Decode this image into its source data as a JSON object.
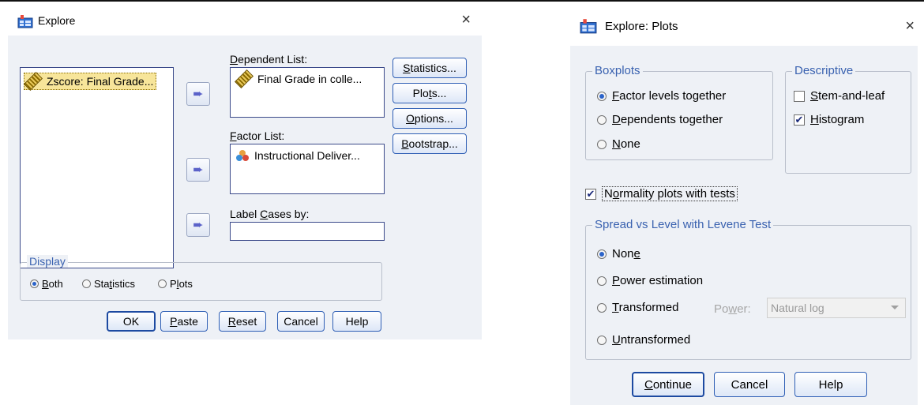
{
  "explore": {
    "title": "Explore",
    "close": "×",
    "variables": [
      {
        "label": "Zscore: Final Grade...",
        "icon": "ruler-icon"
      }
    ],
    "dependent_list": {
      "label_pre": "",
      "label_ul": "D",
      "label_post": "ependent List:",
      "items": [
        "Final Grade in colle..."
      ]
    },
    "factor_list": {
      "label_pre": "",
      "label_ul": "F",
      "label_post": "actor List:",
      "items": [
        "Instructional Deliver..."
      ]
    },
    "label_cases": {
      "label_pre": "Label ",
      "label_ul": "C",
      "label_post": "ases by:",
      "value": ""
    },
    "side_buttons": [
      {
        "pre": "",
        "ul": "S",
        "post": "tatistics..."
      },
      {
        "pre": "Plo",
        "ul": "t",
        "post": "s..."
      },
      {
        "pre": "",
        "ul": "O",
        "post": "ptions..."
      },
      {
        "pre": "",
        "ul": "B",
        "post": "ootstrap..."
      }
    ],
    "display": {
      "title": "Display",
      "options": [
        {
          "pre": "",
          "ul": "B",
          "post": "oth",
          "checked": true
        },
        {
          "pre": "Sta",
          "ul": "t",
          "post": "istics",
          "checked": false
        },
        {
          "pre": "P",
          "ul": "l",
          "post": "ots",
          "checked": false
        }
      ]
    },
    "buttons": [
      {
        "pre": "OK",
        "ul": "",
        "post": ""
      },
      {
        "pre": "",
        "ul": "P",
        "post": "aste"
      },
      {
        "pre": "",
        "ul": "R",
        "post": "eset"
      },
      {
        "pre": "Cancel",
        "ul": "",
        "post": ""
      },
      {
        "pre": "Help",
        "ul": "",
        "post": ""
      }
    ]
  },
  "plots": {
    "title": "Explore: Plots",
    "close": "×",
    "boxplots": {
      "title": "Boxplots",
      "options": [
        {
          "pre": "",
          "ul": "F",
          "post": "actor levels together",
          "checked": true
        },
        {
          "pre": "",
          "ul": "D",
          "post": "ependents together",
          "checked": false
        },
        {
          "pre": "",
          "ul": "N",
          "post": "one",
          "checked": false
        }
      ]
    },
    "descriptive": {
      "title": "Descriptive",
      "options": [
        {
          "pre": "",
          "ul": "S",
          "post": "tem-and-leaf",
          "checked": false,
          "mark": ""
        },
        {
          "pre": "",
          "ul": "H",
          "post": "istogram",
          "checked": true,
          "mark": "✔"
        }
      ]
    },
    "normality": {
      "pre": "N",
      "ul": "o",
      "post": "rmality plots with tests",
      "checked": true,
      "mark": "✔"
    },
    "spread": {
      "title": "Spread vs Level with Levene Test",
      "options": [
        {
          "pre": "Non",
          "ul": "e",
          "post": "",
          "checked": true
        },
        {
          "pre": "",
          "ul": "P",
          "post": "ower estimation",
          "checked": false
        },
        {
          "pre": "",
          "ul": "T",
          "post": "ransformed",
          "checked": false
        },
        {
          "pre": "",
          "ul": "U",
          "post": "ntransformed",
          "checked": false
        }
      ],
      "power_label_pre": "Po",
      "power_label_ul": "w",
      "power_label_post": "er:",
      "power_value": "Natural log"
    },
    "buttons": [
      {
        "pre": "",
        "ul": "C",
        "post": "ontinue"
      },
      {
        "pre": "Cancel",
        "ul": "",
        "post": ""
      },
      {
        "pre": "Help",
        "ul": "",
        "post": ""
      }
    ]
  }
}
